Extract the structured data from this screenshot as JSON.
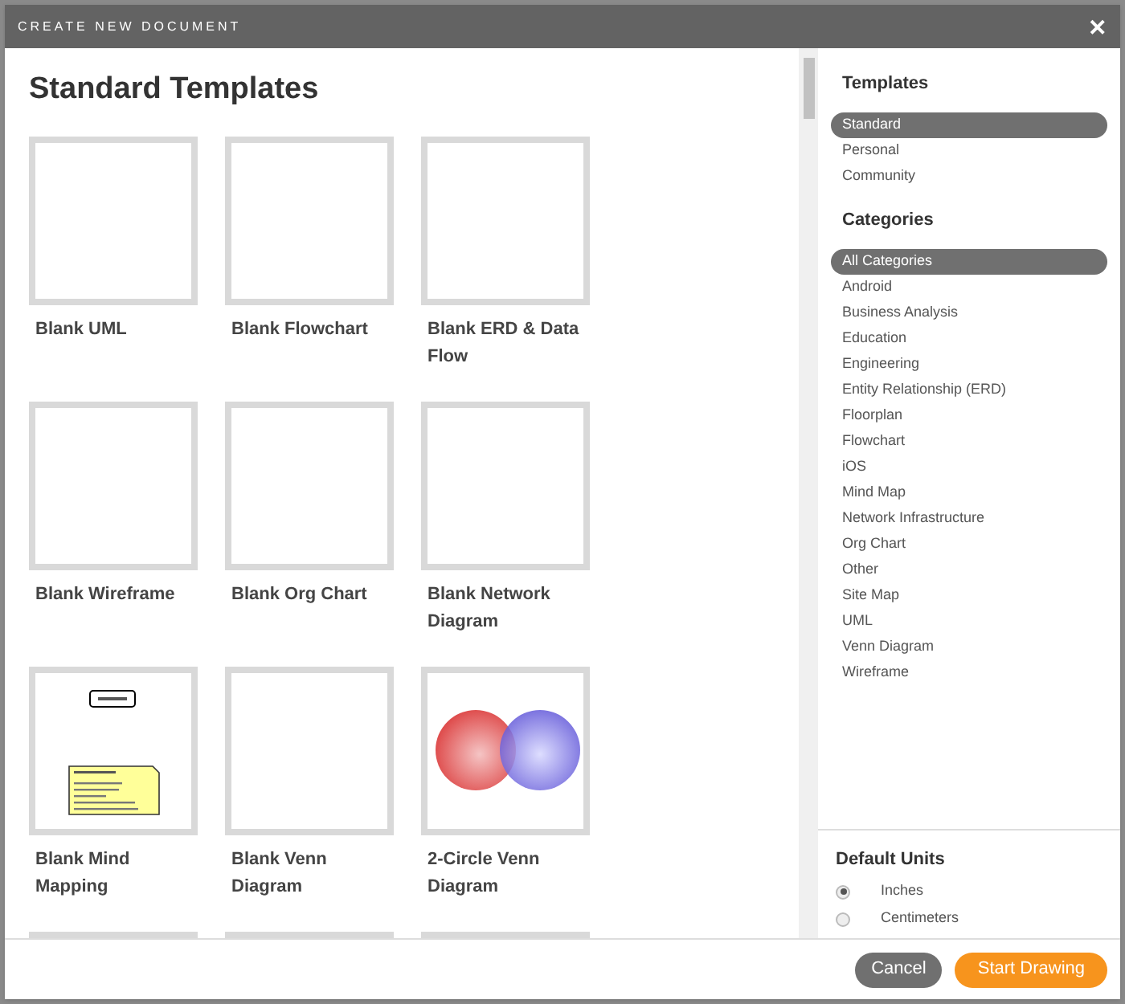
{
  "dialog": {
    "title": "CREATE NEW DOCUMENT",
    "close": "✕"
  },
  "main": {
    "heading": "Standard Templates",
    "templates": [
      {
        "label": "Blank UML",
        "kind": "blank"
      },
      {
        "label": "Blank Flowchart",
        "kind": "blank"
      },
      {
        "label": "Blank ERD & Data Flow",
        "kind": "blank"
      },
      {
        "label": "Blank Wireframe",
        "kind": "blank"
      },
      {
        "label": "Blank Org Chart",
        "kind": "blank"
      },
      {
        "label": "Blank Network Diagram",
        "kind": "blank"
      },
      {
        "label": "Blank Mind Mapping",
        "kind": "mind_map"
      },
      {
        "label": "Blank Venn Diagram",
        "kind": "blank"
      },
      {
        "label": "2-Circle Venn Diagram",
        "kind": "venn"
      },
      {
        "kind": "blank"
      },
      {
        "kind": "blank"
      },
      {
        "kind": "blank"
      }
    ]
  },
  "sidebar": {
    "templates_heading": "Templates",
    "templates": [
      {
        "label": "Standard",
        "selected": true
      },
      {
        "label": "Personal",
        "selected": false
      },
      {
        "label": "Community",
        "selected": false
      }
    ],
    "categories_heading": "Categories",
    "categories": [
      {
        "label": "All Categories",
        "selected": true
      },
      {
        "label": "Android",
        "selected": false
      },
      {
        "label": "Business Analysis",
        "selected": false
      },
      {
        "label": "Education",
        "selected": false
      },
      {
        "label": "Engineering",
        "selected": false
      },
      {
        "label": "Entity Relationship (ERD)",
        "selected": false
      },
      {
        "label": "Floorplan",
        "selected": false
      },
      {
        "label": "Flowchart",
        "selected": false
      },
      {
        "label": "iOS",
        "selected": false
      },
      {
        "label": "Mind Map",
        "selected": false
      },
      {
        "label": "Network Infrastructure",
        "selected": false
      },
      {
        "label": "Org Chart",
        "selected": false
      },
      {
        "label": "Other",
        "selected": false
      },
      {
        "label": "Site Map",
        "selected": false
      },
      {
        "label": "UML",
        "selected": false
      },
      {
        "label": "Venn Diagram",
        "selected": false
      },
      {
        "label": "Wireframe",
        "selected": false
      }
    ],
    "units_heading": "Default Units",
    "units": [
      {
        "label": "Inches",
        "selected": true
      },
      {
        "label": "Centimeters",
        "selected": false
      }
    ]
  },
  "footer": {
    "cancel": "Cancel",
    "start": "Start Drawing"
  }
}
